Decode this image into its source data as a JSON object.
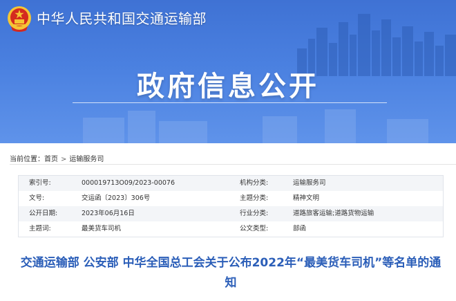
{
  "header": {
    "ministry_name": "中华人民共和国交通运输部",
    "banner_title": "政府信息公开"
  },
  "breadcrumb": {
    "label": "当前位置：",
    "items": [
      "首页",
      "运输服务司"
    ],
    "separator": ">"
  },
  "info": {
    "rows": [
      {
        "label1": "索引号:",
        "value1": "000019713O09/2023-00076",
        "label2": "机构分类:",
        "value2": "运输服务司"
      },
      {
        "label1": "文号:",
        "value1": "交运函〔2023〕306号",
        "label2": "主题分类:",
        "value2": "精神文明"
      },
      {
        "label1": "公开日期:",
        "value1": "2023年06月16日",
        "label2": "行业分类:",
        "value2": "道路旅客运输;道路货物运输"
      },
      {
        "label1": "主题词:",
        "value1": "最美货车司机",
        "label2": "公文类型:",
        "value2": "部函"
      }
    ]
  },
  "article": {
    "title": "交通运输部 公安部 中华全国总工会关于公布2022年“最美货车司机”等名单的通知"
  },
  "colors": {
    "banner_blue": "#4a80e0",
    "title_blue": "#2b5eb8",
    "emblem_red": "#d42a1f",
    "emblem_gold": "#f5c534"
  }
}
